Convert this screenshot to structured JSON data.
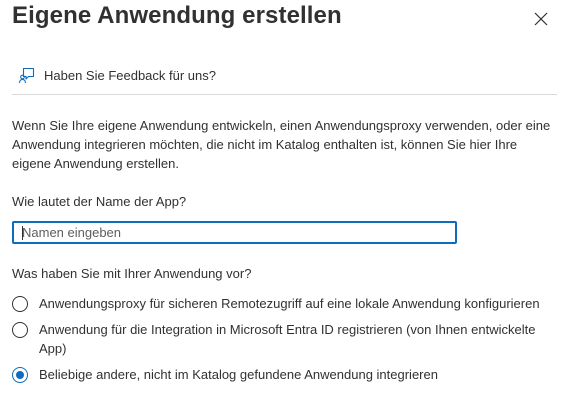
{
  "panel": {
    "title": "Eigene Anwendung erstellen",
    "close_icon": "close-icon"
  },
  "feedback": {
    "icon": "feedback-icon",
    "label": "Haben Sie Feedback für uns?"
  },
  "description": "Wenn Sie Ihre eigene Anwendung entwickeln, einen Anwendungsproxy verwenden, oder eine Anwendung integrieren möchten, die nicht im Katalog enthalten ist, können Sie hier Ihre eigene Anwendung erstellen.",
  "name_field": {
    "label": "Wie lautet der Name der App?",
    "placeholder": "Namen eingeben",
    "value": ""
  },
  "purpose": {
    "question": "Was haben Sie mit Ihrer Anwendung vor?",
    "options": [
      {
        "label": "Anwendungsproxy für sicheren Remotezugriff auf eine lokale Anwendung konfigurieren",
        "selected": false
      },
      {
        "label": "Anwendung für die Integration in Microsoft Entra ID registrieren (von Ihnen entwickelte App)",
        "selected": false
      },
      {
        "label": "Beliebige andere, nicht im Katalog gefundene Anwendung integrieren",
        "selected": true
      }
    ]
  },
  "colors": {
    "accent": "#0f6cbd",
    "text": "#323130",
    "divider": "#d9d9d9"
  }
}
